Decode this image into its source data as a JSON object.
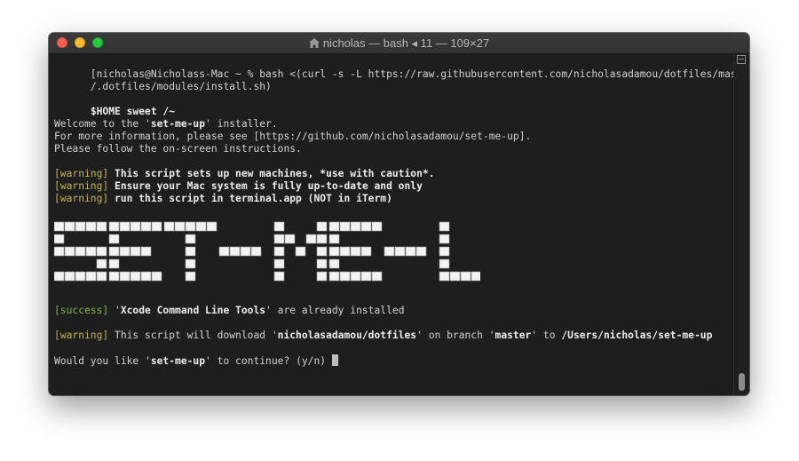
{
  "window": {
    "title": "nicholas — bash ◂ 11 — 109×27",
    "icon": "home-icon"
  },
  "terminal": {
    "lines": [
      {
        "segments": [
          {
            "text": "[nicholas@Nicholass-Mac ~ % bash <(curl -s -L https://raw.githubusercontent.com/nicholasadamou/dotfiles/master]",
            "style": "plain"
          }
        ]
      },
      {
        "segments": [
          {
            "text": "/.dotfiles/modules/install.sh)",
            "style": "plain"
          }
        ]
      },
      {
        "segments": [
          {
            "text": "$HOME sweet /~",
            "style": "bold"
          }
        ]
      },
      {
        "segments": [
          {
            "text": "Welcome to the '",
            "style": "plain"
          },
          {
            "text": "set-me-up",
            "style": "bold"
          },
          {
            "text": "' installer.",
            "style": "plain"
          }
        ]
      },
      {
        "segments": [
          {
            "text": "For more information, please see [https://github.com/nicholasadamou/set-me-up].",
            "style": "plain"
          }
        ]
      },
      {
        "segments": [
          {
            "text": "Please follow the on-screen instructions.",
            "style": "plain"
          }
        ]
      },
      {
        "segments": [
          {
            "text": "[warning]",
            "style": "warn"
          },
          {
            "text": " This script sets up new machines, *use with caution*.",
            "style": "bold"
          }
        ]
      },
      {
        "segments": [
          {
            "text": "[warning]",
            "style": "warn"
          },
          {
            "text": " Ensure your Mac system is fully up-to-date and only",
            "style": "bold"
          }
        ]
      },
      {
        "segments": [
          {
            "text": "[warning]",
            "style": "warn"
          },
          {
            "text": " run this script in terminal.app (NOT in iTerm)",
            "style": "bold"
          }
        ]
      },
      {
        "segments": [
          {
            "text": "[success]",
            "style": "succ"
          },
          {
            "text": " '",
            "style": "plain"
          },
          {
            "text": "Xcode Command Line Tools",
            "style": "bold"
          },
          {
            "text": "' are already installed",
            "style": "plain"
          }
        ]
      },
      {
        "segments": [
          {
            "text": "[warning]",
            "style": "warn"
          },
          {
            "text": " This script will download '",
            "style": "plain"
          },
          {
            "text": "nicholasadamou/dotfiles",
            "style": "bold"
          },
          {
            "text": "' on branch '",
            "style": "plain"
          },
          {
            "text": "master",
            "style": "bold"
          },
          {
            "text": "' to ",
            "style": "plain"
          },
          {
            "text": "/Users/nicholas/set-me-up",
            "style": "bold"
          }
        ]
      },
      {
        "segments": [
          {
            "text": "Would you like '",
            "style": "plain"
          },
          {
            "text": "set-me-up",
            "style": "bold"
          },
          {
            "text": "' to continue? (y/n) ",
            "style": "plain"
          }
        ]
      }
    ],
    "banner": "SET-ME-UP",
    "banner_letters": [
      "S",
      "E",
      "T",
      "-",
      "M",
      "E",
      "-",
      "U",
      "P"
    ]
  },
  "colors": {
    "background": "#1e1e1e",
    "text": "#d2d2d2",
    "warning": "#c8b53a",
    "success": "#7fb93c"
  }
}
